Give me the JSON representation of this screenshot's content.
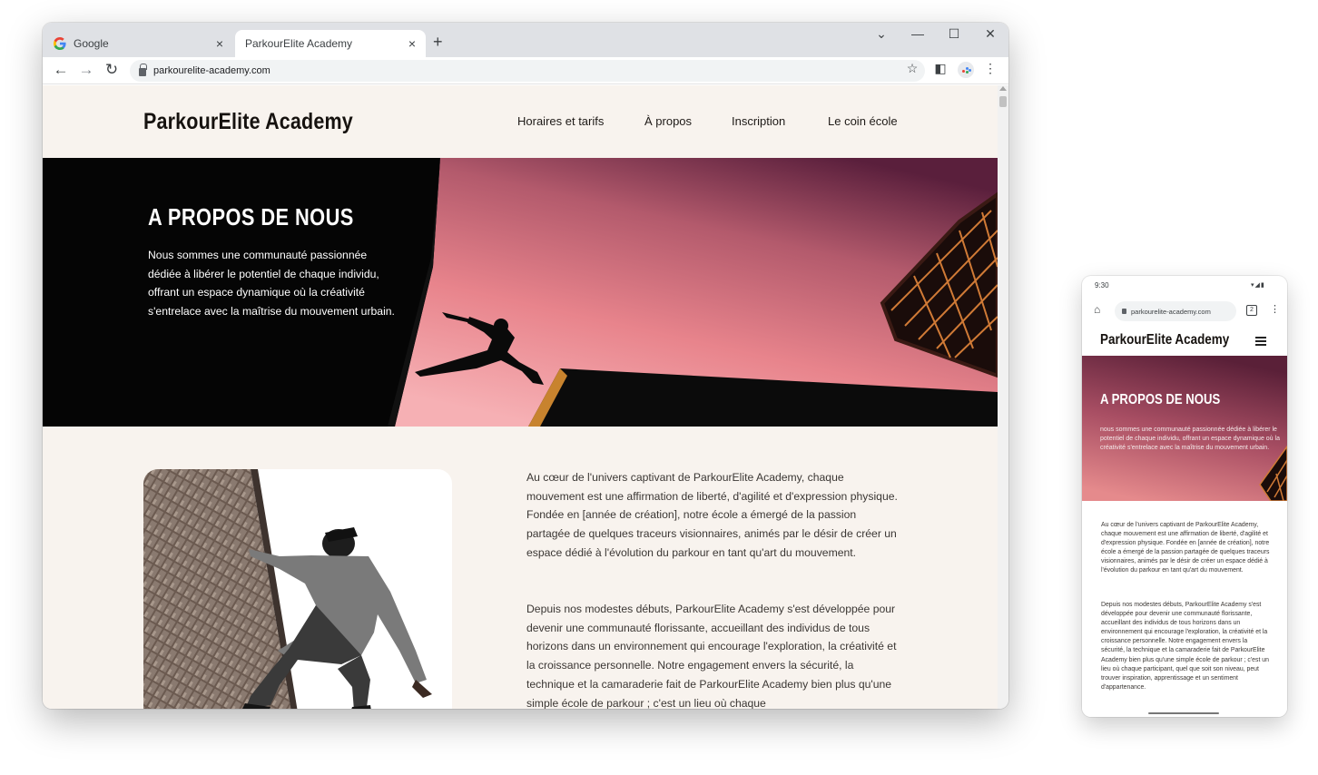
{
  "browser": {
    "tabs": [
      {
        "title": "Google",
        "close": "×"
      },
      {
        "title": "ParkourElite Academy",
        "close": "×"
      }
    ],
    "new_tab": "+",
    "window_controls": {
      "minimize": "—",
      "maximize": "☐",
      "close": "✕",
      "tab_search": "⌄"
    },
    "url": "parkourelite-academy.com"
  },
  "site": {
    "logo": "ParkourElite Academy",
    "menu": [
      "Horaires et tarifs",
      "À propos",
      "Inscription",
      "Le coin école"
    ],
    "hero": {
      "title": "A PROPOS DE NOUS",
      "text": "Nous sommes une communauté passionnée dédiée à libérer le potentiel de chaque individu, offrant un espace dynamique où la créativité s'entrelace avec la maîtrise du mouvement urbain."
    },
    "paragraphs": [
      "Au cœur de l'univers captivant de ParkourElite Academy, chaque mouvement est une affirmation de liberté, d'agilité et d'expression physique. Fondée en [année de création], notre école a émergé de la passion partagée de quelques traceurs visionnaires, animés par le désir de créer un espace dédié à l'évolution du parkour en tant qu'art du mouvement.",
      "Depuis nos modestes débuts, ParkourElite Academy s'est développée pour devenir une communauté florissante, accueillant des individus de tous horizons dans un environnement qui encourage l'exploration, la créativité et la croissance personnelle. Notre engagement envers la sécurité, la technique et la camaraderie fait de ParkourElite Academy bien plus qu'une simple école de parkour ; c'est un lieu où chaque"
    ]
  },
  "phone": {
    "time": "9:30",
    "status_icons": "▾◢▮",
    "url": "parkourelite-academy.com",
    "tab_count": "2",
    "logo": "ParkourElite Academy",
    "hero_title": "A PROPOS DE NOUS",
    "hero_text": "nous sommes une communauté passionnée dédiée à libérer le potentiel de chaque individu, offrant un espace dynamique où la créativité s'entrelace avec la maîtrise du mouvement urbain.",
    "paragraphs": [
      "Au cœur de l'univers captivant de ParkourElite Academy, chaque mouvement est une affirmation de liberté, d'agilité et d'expression physique. Fondée en [année de création], notre école a émergé de la passion partagée de quelques traceurs visionnaires, animés par le désir de créer un espace dédié à l'évolution du parkour en tant qu'art du mouvement.",
      "Depuis nos modestes débuts, ParkourElite Academy s'est développée pour devenir une communauté florissante, accueillant des individus de tous horizons dans un environnement qui encourage l'exploration, la créativité et la croissance personnelle. Notre engagement envers la sécurité, la technique et la camaraderie fait de ParkourElite Academy bien plus qu'une simple école de parkour ; c'est un lieu où chaque participant, quel que soit son niveau, peut trouver inspiration, apprentissage et un sentiment d'appartenance."
    ]
  },
  "icons": {
    "back": "←",
    "forward": "→",
    "reload": "↻",
    "star": "☆",
    "side_panel": "◧",
    "more": "⋮",
    "home": "⌂"
  },
  "colors": {
    "page_bg": "#f8f3ee",
    "hero_black": "#050505",
    "sky_top": "#5a1f3c",
    "sky_bottom": "#f4a0a0",
    "text_dark": "#3b3734"
  }
}
